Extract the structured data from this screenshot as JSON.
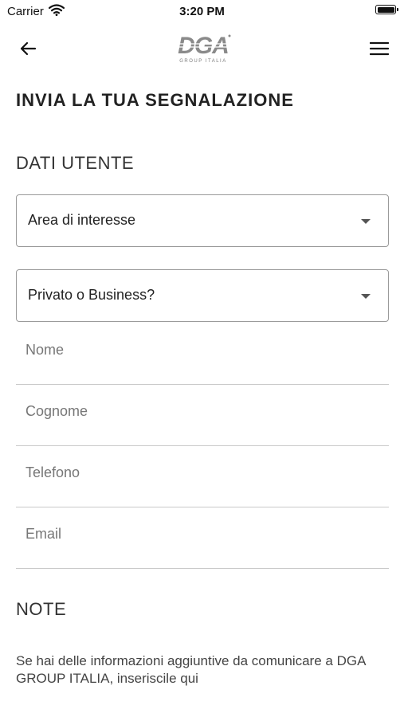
{
  "status_bar": {
    "carrier": "Carrier",
    "time": "3:20 PM"
  },
  "nav": {
    "logo_text": "DGA",
    "logo_subtext": "GROUP ITALIA",
    "back_icon": "arrow-left-icon",
    "menu_icon": "hamburger-menu-icon"
  },
  "page": {
    "title": "INVIA LA TUA SEGNALAZIONE"
  },
  "user_section": {
    "title": "DATI UTENTE",
    "area_select": {
      "value": "Area di interesse"
    },
    "type_select": {
      "value": "Privato o Business?"
    },
    "fields": {
      "nome": {
        "placeholder": "Nome"
      },
      "cognome": {
        "placeholder": "Cognome"
      },
      "telefono": {
        "placeholder": "Telefono"
      },
      "email": {
        "placeholder": "Email"
      }
    }
  },
  "note_section": {
    "title": "NOTE",
    "description": "Se hai delle informazioni aggiuntive da comunicare a DGA GROUP ITALIA, inseriscile qui"
  }
}
